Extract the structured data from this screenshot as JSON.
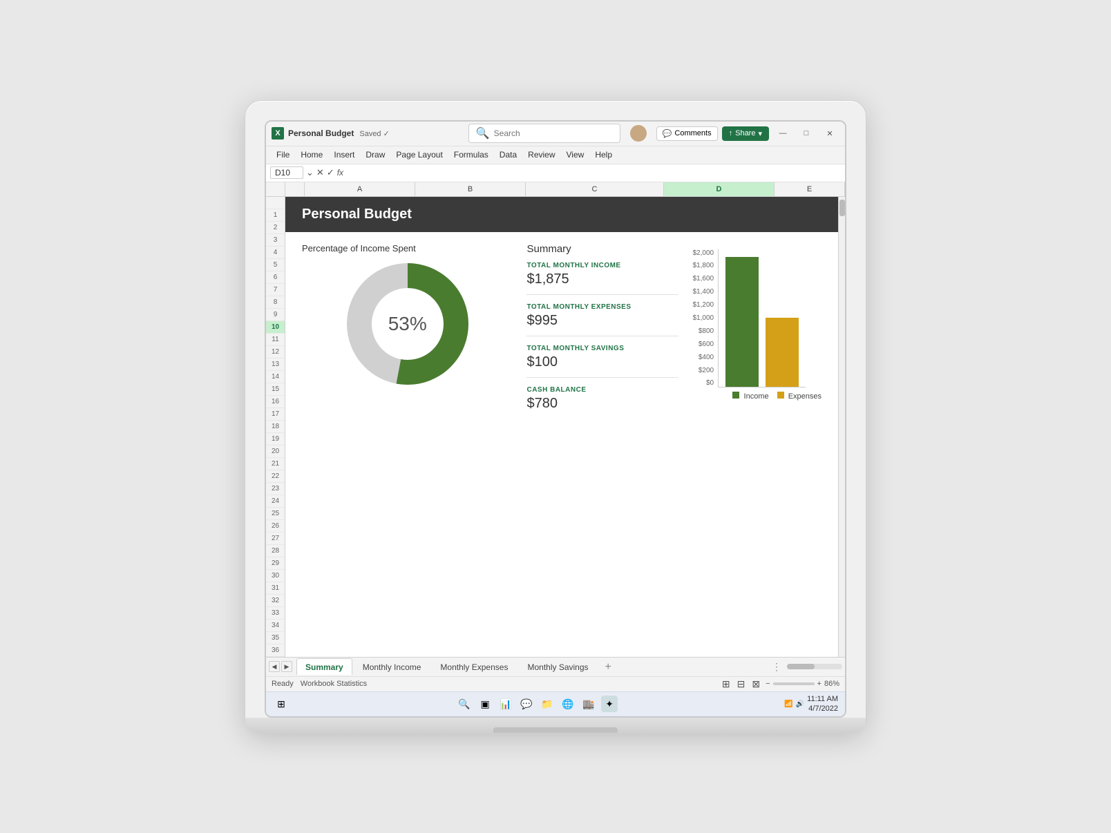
{
  "window": {
    "title": "Personal Budget",
    "saved_label": "Saved ✓",
    "search_placeholder": "Search",
    "comments_label": "Comments",
    "share_label": "Share"
  },
  "menu": {
    "items": [
      "File",
      "Home",
      "Insert",
      "Draw",
      "Page Layout",
      "Formulas",
      "Data",
      "Review",
      "View",
      "Help"
    ]
  },
  "formula_bar": {
    "cell_ref": "D10",
    "formula": "fx"
  },
  "columns": {
    "headers": [
      "A",
      "B",
      "C",
      "D",
      "E"
    ]
  },
  "dashboard": {
    "title": "Personal Budget",
    "section_title": "Percentage of Income Spent",
    "donut_percent": "53%",
    "donut_green_pct": 53,
    "summary": {
      "title": "Summary",
      "items": [
        {
          "label": "TOTAL MONTHLY INCOME",
          "value": "$1,875"
        },
        {
          "label": "TOTAL MONTHLY EXPENSES",
          "value": "$995"
        },
        {
          "label": "TOTAL MONTHLY SAVINGS",
          "value": "$100"
        },
        {
          "label": "CASH BALANCE",
          "value": "$780"
        }
      ]
    },
    "chart": {
      "y_labels": [
        "$2,000",
        "$1,800",
        "$1,600",
        "$1,400",
        "$1,200",
        "$1,000",
        "$800",
        "$600",
        "$400",
        "$200",
        "$0"
      ],
      "income_value": 1875,
      "expenses_value": 995,
      "max_value": 2000,
      "income_label": "Income",
      "expenses_label": "Expenses",
      "income_color": "#4a7c2f",
      "expenses_color": "#d4a017"
    }
  },
  "sheet_tabs": {
    "tabs": [
      "Summary",
      "Monthly Income",
      "Monthly Expenses",
      "Monthly Savings"
    ],
    "active_tab": "Summary"
  },
  "status_bar": {
    "ready": "Ready",
    "workbook_stats": "Workbook Statistics",
    "zoom": "86%"
  },
  "taskbar": {
    "time": "11:11 AM",
    "date": "4/7/2022",
    "icons": [
      "⊞",
      "🔍",
      "▣",
      "📦",
      "💬",
      "📁",
      "🌐",
      "🏬",
      "✦"
    ]
  }
}
